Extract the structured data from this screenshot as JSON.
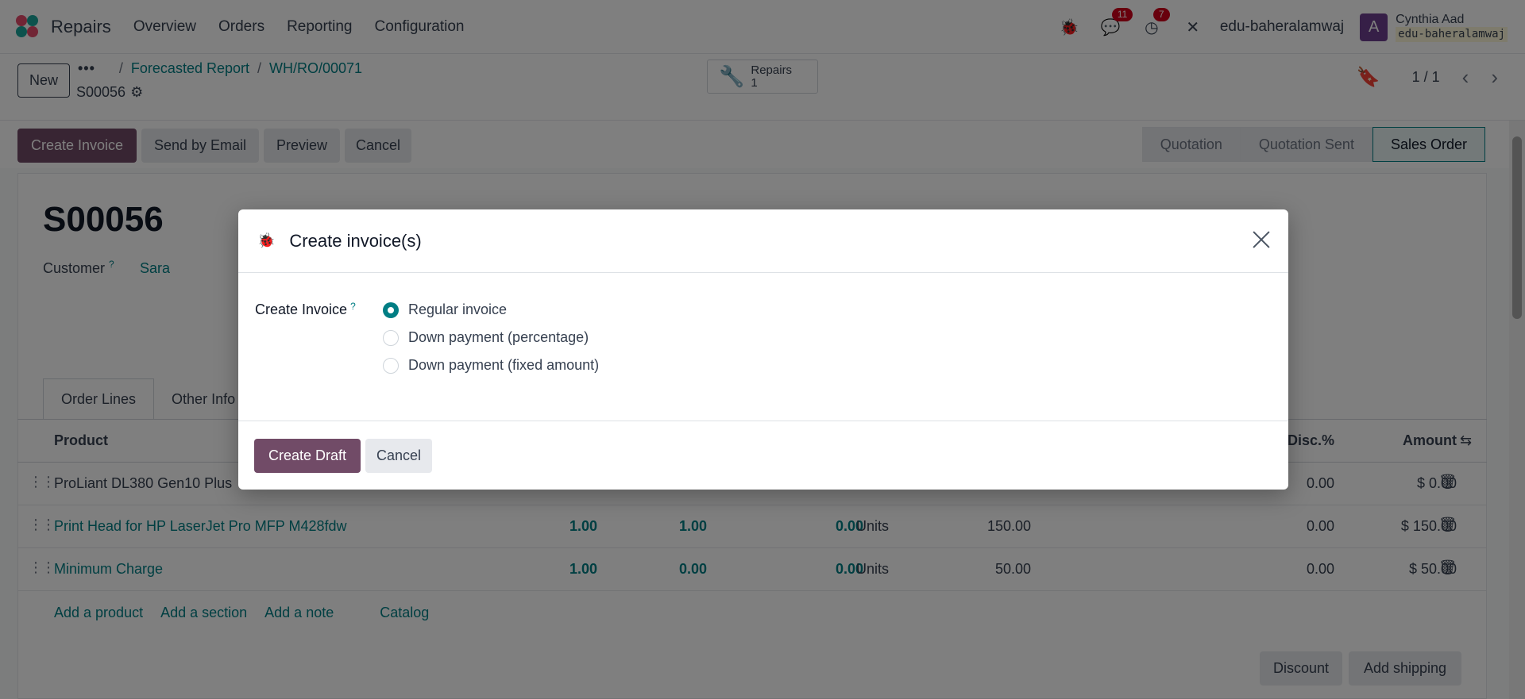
{
  "navbar": {
    "app_name": "Repairs",
    "menu": [
      "Overview",
      "Orders",
      "Reporting",
      "Configuration"
    ],
    "messages_count": "11",
    "activities_count": "7",
    "db_name": "edu-baheralamwaj",
    "avatar_letter": "A",
    "user_name": "Cynthia Aad",
    "user_db": "edu-baheralamwaj"
  },
  "control_panel": {
    "new_label": "New",
    "breadcrumb": [
      "Forecasted Report",
      "WH/RO/00071"
    ],
    "record_name": "S00056",
    "smart_button": {
      "label": "Repairs",
      "count": "1"
    },
    "pager": "1 / 1"
  },
  "statusbar": {
    "buttons": [
      "Create Invoice",
      "Send by Email",
      "Preview",
      "Cancel"
    ],
    "stages": [
      "Quotation",
      "Quotation Sent",
      "Sales Order"
    ],
    "active_stage": "Sales Order"
  },
  "form": {
    "title": "S00056",
    "customer_label": "Customer",
    "customer_value": "Sara",
    "tabs": [
      "Order Lines",
      "Other Info"
    ],
    "columns": {
      "product": "Product",
      "disc": "Disc.%",
      "amount": "Amount"
    },
    "rows": [
      {
        "product": "ProLiant DL380 Gen10 Plus",
        "qty": "",
        "delivered": "",
        "invoiced": "",
        "uom": "",
        "price": "",
        "disc": "0.00",
        "amount": "$ 0.00"
      },
      {
        "product": "Print Head for HP LaserJet Pro MFP M428fdw",
        "qty": "1.00",
        "delivered": "1.00",
        "invoiced": "0.00",
        "uom": "Units",
        "price": "150.00",
        "disc": "0.00",
        "amount": "$ 150.00"
      },
      {
        "product": "Minimum Charge",
        "qty": "1.00",
        "delivered": "0.00",
        "invoiced": "0.00",
        "uom": "Units",
        "price": "50.00",
        "disc": "0.00",
        "amount": "$ 50.00"
      }
    ],
    "add_links": [
      "Add a product",
      "Add a section",
      "Add a note",
      "Catalog"
    ],
    "bottom_buttons": [
      "Discount",
      "Add shipping"
    ]
  },
  "dialog": {
    "title": "Create invoice(s)",
    "field_label": "Create Invoice",
    "field_help": "?",
    "options": [
      {
        "label": "Regular invoice",
        "checked": true
      },
      {
        "label": "Down payment (percentage)",
        "checked": false
      },
      {
        "label": "Down payment (fixed amount)",
        "checked": false
      }
    ],
    "create_draft_label": "Create Draft",
    "cancel_label": "Cancel"
  },
  "colors": {
    "brand": "#714b67",
    "link": "#017e84",
    "badge": "#d0011b"
  }
}
